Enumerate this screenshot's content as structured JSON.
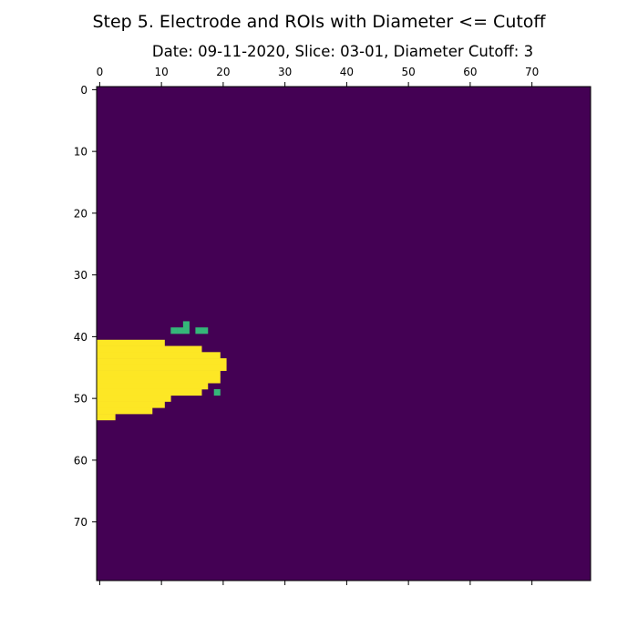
{
  "figure": {
    "suptitle": "Step 5. Electrode and ROIs with Diameter <= Cutoff",
    "title": "Date: 09-11-2020, Slice: 03-01, Diameter Cutoff: 3"
  },
  "chart_data": {
    "type": "heatmap",
    "title": "Date: 09-11-2020, Slice: 03-01, Diameter Cutoff: 3",
    "xlabel": "",
    "ylabel": "",
    "rows": 80,
    "cols": 80,
    "xlim": [
      -0.5,
      79.5
    ],
    "ylim": [
      79.5,
      -0.5
    ],
    "x_axis_position": "top",
    "x_ticks": [
      0,
      10,
      20,
      30,
      40,
      50,
      60,
      70
    ],
    "y_ticks": [
      0,
      10,
      20,
      30,
      40,
      50,
      60,
      70
    ],
    "grid": false,
    "colormap": "viridis",
    "value_colors": {
      "0": "#440154",
      "1": "#35b779",
      "2": "#fde725"
    },
    "background_value": 0,
    "electrode": {
      "value": 2,
      "row_ranges": [
        [
          41,
          0,
          10
        ],
        [
          42,
          0,
          16
        ],
        [
          43,
          0,
          19
        ],
        [
          44,
          0,
          20
        ],
        [
          45,
          0,
          20
        ],
        [
          46,
          0,
          19
        ],
        [
          47,
          0,
          19
        ],
        [
          48,
          0,
          17
        ],
        [
          49,
          0,
          16
        ],
        [
          50,
          0,
          11
        ],
        [
          51,
          0,
          10
        ],
        [
          52,
          0,
          8
        ],
        [
          53,
          0,
          2
        ]
      ]
    },
    "rois": {
      "value": 1,
      "pixels": [
        [
          38,
          14
        ],
        [
          39,
          12
        ],
        [
          39,
          13
        ],
        [
          39,
          14
        ],
        [
          39,
          16
        ],
        [
          39,
          17
        ],
        [
          49,
          19
        ]
      ]
    }
  }
}
